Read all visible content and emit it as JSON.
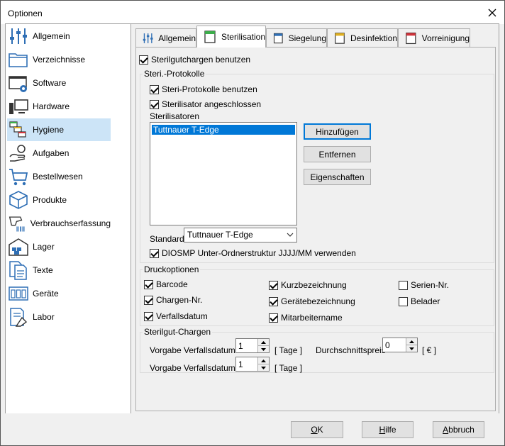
{
  "window": {
    "title": "Optionen"
  },
  "sidebar": {
    "items": [
      {
        "label": "Allgemein",
        "icon": "sliders-icon"
      },
      {
        "label": "Verzeichnisse",
        "icon": "folder-icon"
      },
      {
        "label": "Software",
        "icon": "software-icon"
      },
      {
        "label": "Hardware",
        "icon": "computer-icon"
      },
      {
        "label": "Hygiene",
        "icon": "hygiene-icon"
      },
      {
        "label": "Aufgaben",
        "icon": "hand-task-icon"
      },
      {
        "label": "Bestellwesen",
        "icon": "cart-icon"
      },
      {
        "label": "Produkte",
        "icon": "box-icon"
      },
      {
        "label": "Verbrauchserfassung",
        "icon": "barcode-scanner-icon"
      },
      {
        "label": "Lager",
        "icon": "warehouse-icon"
      },
      {
        "label": "Texte",
        "icon": "documents-icon"
      },
      {
        "label": "Geräte",
        "icon": "devices-icon"
      },
      {
        "label": "Labor",
        "icon": "lab-icon"
      }
    ],
    "selected": "Hygiene"
  },
  "tabs": [
    {
      "label": "Allgemein"
    },
    {
      "label": "Sterilisation"
    },
    {
      "label": "Siegelung"
    },
    {
      "label": "Desinfektion"
    },
    {
      "label": "Vorreinigung"
    }
  ],
  "sterilisation": {
    "use_batches": {
      "label": "Sterilgutchargen benutzen",
      "checked": true
    },
    "protocols_group": "Steri.-Protokolle",
    "use_protocols": {
      "label": "Steri-Protokolle benutzen",
      "checked": true
    },
    "sterilizer_connected": {
      "label": "Sterilisator angeschlossen",
      "checked": true
    },
    "sterilizers_label": "Sterilisatoren",
    "sterilizers": [
      "Tuttnauer T-Edge"
    ],
    "buttons": {
      "add": "Hinzufügen",
      "remove": "Entfernen",
      "properties": "Eigenschaften"
    },
    "standard_label": "Standard",
    "standard_value": "Tuttnauer T-Edge",
    "diosmp": {
      "label": "DIOSMP Unter-Ordnerstruktur JJJJ/MM verwenden",
      "checked": true
    }
  },
  "print_options": {
    "group": "Druckoptionen",
    "barcode": {
      "label": "Barcode",
      "checked": true
    },
    "batch_no": {
      "label": "Chargen-Nr.",
      "checked": true
    },
    "expiry": {
      "label": "Verfallsdatum",
      "checked": true
    },
    "short_name": {
      "label": "Kurzbezeichnung",
      "checked": true
    },
    "device_name": {
      "label": "Gerätebezeichnung",
      "checked": true
    },
    "employee": {
      "label": "Mitarbeitername",
      "checked": true
    },
    "serial": {
      "label": "Serien-Nr.",
      "checked": false
    },
    "loader": {
      "label": "Belader",
      "checked": false
    }
  },
  "steril_batches": {
    "group": "Sterilgut-Chargen",
    "expiry1_label": "Vorgabe Verfallsdatum 1",
    "expiry1_value": "1",
    "expiry2_label": "Vorgabe Verfallsdatum 2",
    "expiry2_value": "1",
    "unit_days": "[ Tage ]",
    "avg_price_label": "Durchschnittspreis",
    "avg_price_value": "0",
    "unit_currency": "[ € ]"
  },
  "footer": {
    "ok_prefix": "",
    "ok_ul": "O",
    "ok_rest": "K",
    "help_prefix": "",
    "help_ul": "H",
    "help_rest": "ilfe",
    "cancel_prefix": "",
    "cancel_ul": "A",
    "cancel_rest": "bbruch"
  }
}
